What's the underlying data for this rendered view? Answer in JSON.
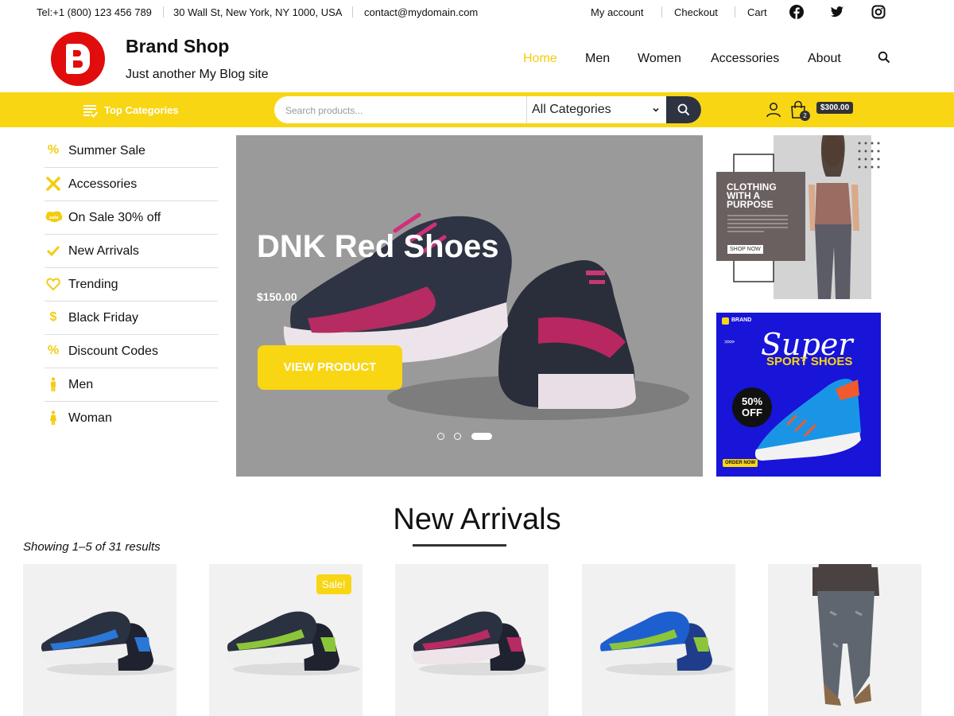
{
  "topbar": {
    "phone": "Tel:+1 (800) 123 456 789",
    "address": "30 Wall St, New York, NY 1000, USA",
    "email": "contact@mydomain.com",
    "links": [
      "My account",
      "Checkout",
      "Cart"
    ],
    "social": [
      "facebook-icon",
      "twitter-icon",
      "instagram-icon"
    ]
  },
  "brand": {
    "name": "Brand Shop",
    "tagline": "Just another My Blog site",
    "logo_color": "#e10c0c"
  },
  "nav": {
    "items": [
      "Home",
      "Men",
      "Women",
      "Accessories",
      "About"
    ],
    "active": "Home",
    "accent": "#f3cc10"
  },
  "toolbar": {
    "top_categories": "Top Categories",
    "search_placeholder": "Search products...",
    "category_select": "All Categories",
    "cart_count": "2",
    "cart_total": "$300.00",
    "bar_color": "#f8d614"
  },
  "sidebar": {
    "items": [
      {
        "label": "Summer Sale",
        "icon": "percent-icon"
      },
      {
        "label": "Accessories",
        "icon": "tools-icon"
      },
      {
        "label": "On Sale 30% off",
        "icon": "sale-tag-icon"
      },
      {
        "label": "New Arrivals",
        "icon": "check-icon"
      },
      {
        "label": "Trending",
        "icon": "heart-icon"
      },
      {
        "label": "Black Friday",
        "icon": "dollar-icon"
      },
      {
        "label": "Discount Codes",
        "icon": "percent-icon"
      },
      {
        "label": "Men",
        "icon": "male-icon"
      },
      {
        "label": "Woman",
        "icon": "female-icon"
      }
    ]
  },
  "hero": {
    "title": "DNK Red Shoes",
    "price": "$150.00",
    "button": "VIEW PRODUCT",
    "slides": 3,
    "active_slide": 3
  },
  "banner1": {
    "heading_line1": "CLOTHING",
    "heading_line2": "WITH A",
    "heading_line3": "PURPOSE",
    "button": "SHOP NOW"
  },
  "banner2": {
    "brand": "BRAND",
    "title": "Super",
    "subtitle": "SPORT SHOES",
    "discount_line1": "50%",
    "discount_line2": "OFF",
    "button": "ORDER NOW"
  },
  "new_arrivals": {
    "title": "New Arrivals",
    "showing": "Showing 1–5 of 31 results",
    "sale_badge": "Sale!",
    "products": [
      {
        "image": "blue-black-sneakers"
      },
      {
        "image": "green-black-sneakers",
        "sale": true
      },
      {
        "image": "red-black-sneakers"
      },
      {
        "image": "blue-green-sneakers"
      },
      {
        "image": "jeans-model"
      }
    ]
  }
}
